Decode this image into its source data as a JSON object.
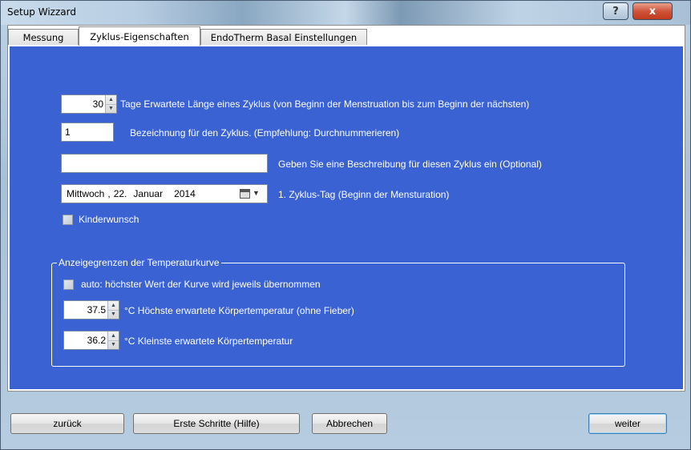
{
  "window": {
    "title": "Setup Wizzard",
    "help_label": "?",
    "close_label": "x"
  },
  "tabs": [
    {
      "label": "Messung",
      "active": false
    },
    {
      "label": "Zyklus-Eigenschaften",
      "active": true
    },
    {
      "label": "EndoTherm Basal Einstellungen",
      "active": false
    }
  ],
  "cycle": {
    "length_value": "30",
    "length_label": "Tage Erwartete Länge eines Zyklus (von Beginn der Menstruation bis zum Beginn der nächsten)",
    "name_value": "1",
    "name_label": "Bezeichnung für den Zyklus. (Empfehlung: Durchnummerieren)",
    "description_value": "",
    "description_label": "Geben Sie eine Beschreibung für diesen Zyklus ein (Optional)",
    "date": {
      "weekday": "Mittwoch",
      "day": "22.",
      "month": "Januar",
      "year": "2014"
    },
    "date_label": "1. Zyklus-Tag (Beginn der Mensturation)",
    "wish_label": "Kinderwunsch",
    "wish_checked": false
  },
  "temperature": {
    "group_title": "Anzeigegrenzen der Temperaturkurve",
    "auto_label": "auto: höchster Wert der Kurve wird jeweils übernommen",
    "auto_checked": false,
    "max_value": "37.5",
    "max_label": "°C Höchste erwartete Körpertemperatur (ohne Fieber)",
    "min_value": "36.2",
    "min_label": "°C Kleinste erwartete Körpertemperatur"
  },
  "buttons": {
    "back": "zurück",
    "help": "Erste Schritte (Hilfe)",
    "cancel": "Abbrechen",
    "next": "weiter"
  },
  "colors": {
    "panel_bg": "#3a62d2",
    "close_button": "#c23a1e"
  },
  "icons": {
    "spin": "up-down-arrows",
    "calendar": "calendar-icon"
  }
}
